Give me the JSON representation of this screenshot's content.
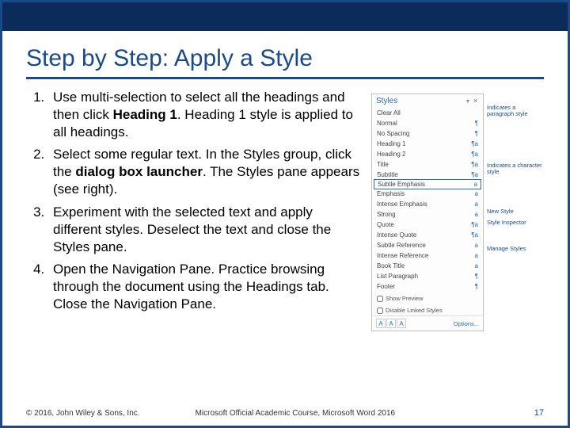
{
  "title": "Step by Step: Apply a Style",
  "steps": [
    {
      "pre": "Use multi-selection to select all the headings and then click ",
      "bold": "Heading 1",
      "post": ". Heading 1 style is applied to all headings."
    },
    {
      "pre": "Select some regular text. In the Styles group, click the ",
      "bold": "dialog box launcher",
      "post": ". The Styles pane appears (see right)."
    },
    {
      "pre": "Experiment with the selected text and apply different styles. Deselect the text and close the Styles pane.",
      "bold": "",
      "post": ""
    },
    {
      "pre": "Open the Navigation Pane. Practice browsing through the document using the Headings tab. Close the Navigation Pane.",
      "bold": "",
      "post": ""
    }
  ],
  "pane": {
    "title": "Styles",
    "items": [
      {
        "label": "Clear All",
        "glyph": ""
      },
      {
        "label": "Normal",
        "glyph": "¶"
      },
      {
        "label": "No Spacing",
        "glyph": "¶"
      },
      {
        "label": "Heading 1",
        "glyph": "¶a"
      },
      {
        "label": "Heading 2",
        "glyph": "¶a"
      },
      {
        "label": "Title",
        "glyph": "¶a"
      },
      {
        "label": "Subtitle",
        "glyph": "¶a"
      },
      {
        "label": "Subtle Emphasis",
        "glyph": "a",
        "selected": true
      },
      {
        "label": "Emphasis",
        "glyph": "a"
      },
      {
        "label": "Intense Emphasis",
        "glyph": "a"
      },
      {
        "label": "Strong",
        "glyph": "a"
      },
      {
        "label": "Quote",
        "glyph": "¶a"
      },
      {
        "label": "Intense Quote",
        "glyph": "¶a"
      },
      {
        "label": "Subtle Reference",
        "glyph": "a"
      },
      {
        "label": "Intense Reference",
        "glyph": "a"
      },
      {
        "label": "Book Title",
        "glyph": "a"
      },
      {
        "label": "List Paragraph",
        "glyph": "¶"
      },
      {
        "label": "Footer",
        "glyph": "¶"
      }
    ],
    "show_preview": "Show Preview",
    "disable_linked": "Disable Linked Styles",
    "options": "Options..."
  },
  "callouts": {
    "c1": "Indicates a paragraph style",
    "c2": "Indicates a character style",
    "c3": "New Style",
    "c4": "Style Inspector",
    "c5": "Manage Styles"
  },
  "footer": {
    "copyright": "© 2016, John Wiley & Sons, Inc.",
    "course": "Microsoft Official Academic Course, Microsoft Word 2016",
    "page": "17"
  }
}
